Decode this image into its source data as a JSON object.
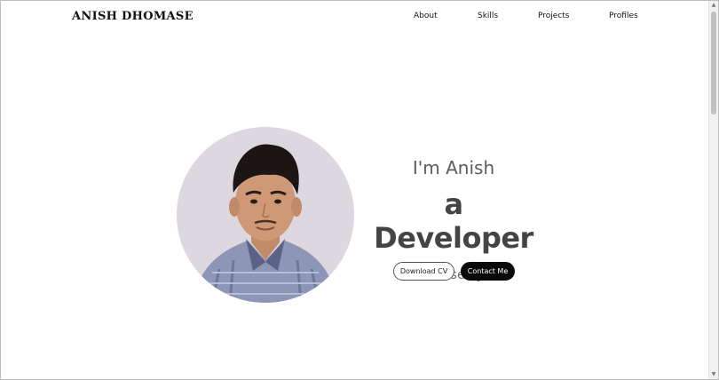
{
  "header": {
    "logo": "ANISH DHOMASE",
    "nav": {
      "about": "About",
      "skills": "Skills",
      "projects": "Projects",
      "profiles": "Profiles"
    }
  },
  "hero": {
    "greeting": "I'm Anish",
    "title": "a Developer",
    "tagline": "Nice to see you!",
    "buttons": {
      "download_cv": "Download CV",
      "contact": "Contact Me"
    }
  },
  "colors": {
    "accent_dark": "#0a0a0a",
    "photo_background": "#ddd7df"
  }
}
